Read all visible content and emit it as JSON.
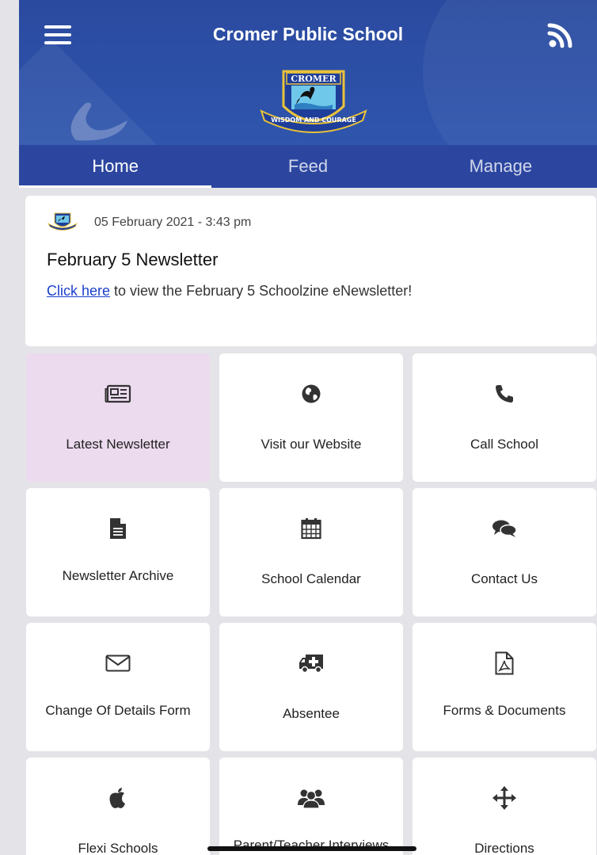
{
  "header": {
    "title": "Cromer Public School",
    "logo_text_top": "CROMER",
    "logo_text_motto": "WISDOM AND COURAGE"
  },
  "tabs": [
    {
      "label": "Home",
      "active": true
    },
    {
      "label": "Feed",
      "active": false
    },
    {
      "label": "Manage",
      "active": false
    }
  ],
  "post": {
    "date": "05 February 2021 - 3:43 pm",
    "title": "February 5 Newsletter",
    "link_text": "Click here",
    "body_text": " to view the February 5 Schoolzine eNewsletter!"
  },
  "tiles": [
    {
      "label": "Latest Newsletter",
      "icon": "newspaper-icon"
    },
    {
      "label": "Visit our Website",
      "icon": "globe-icon"
    },
    {
      "label": "Call School",
      "icon": "phone-icon"
    },
    {
      "label": "Newsletter Archive",
      "icon": "document-icon"
    },
    {
      "label": "School Calendar",
      "icon": "calendar-icon"
    },
    {
      "label": "Contact Us",
      "icon": "chat-icon"
    },
    {
      "label": "Change Of Details Form",
      "icon": "envelope-icon"
    },
    {
      "label": "Absentee",
      "icon": "ambulance-icon"
    },
    {
      "label": "Forms & Documents",
      "icon": "pdf-icon"
    },
    {
      "label": "Flexi Schools",
      "icon": "apple-icon"
    },
    {
      "label": "Parent/Teacher Interviews",
      "icon": "users-icon"
    },
    {
      "label": "Directions",
      "icon": "arrows-icon"
    }
  ],
  "colors": {
    "header": "#2a4a9f",
    "tab_bar": "#2c46a0",
    "highlight_tile": "#ecdaee",
    "link": "#1a3fcc"
  }
}
